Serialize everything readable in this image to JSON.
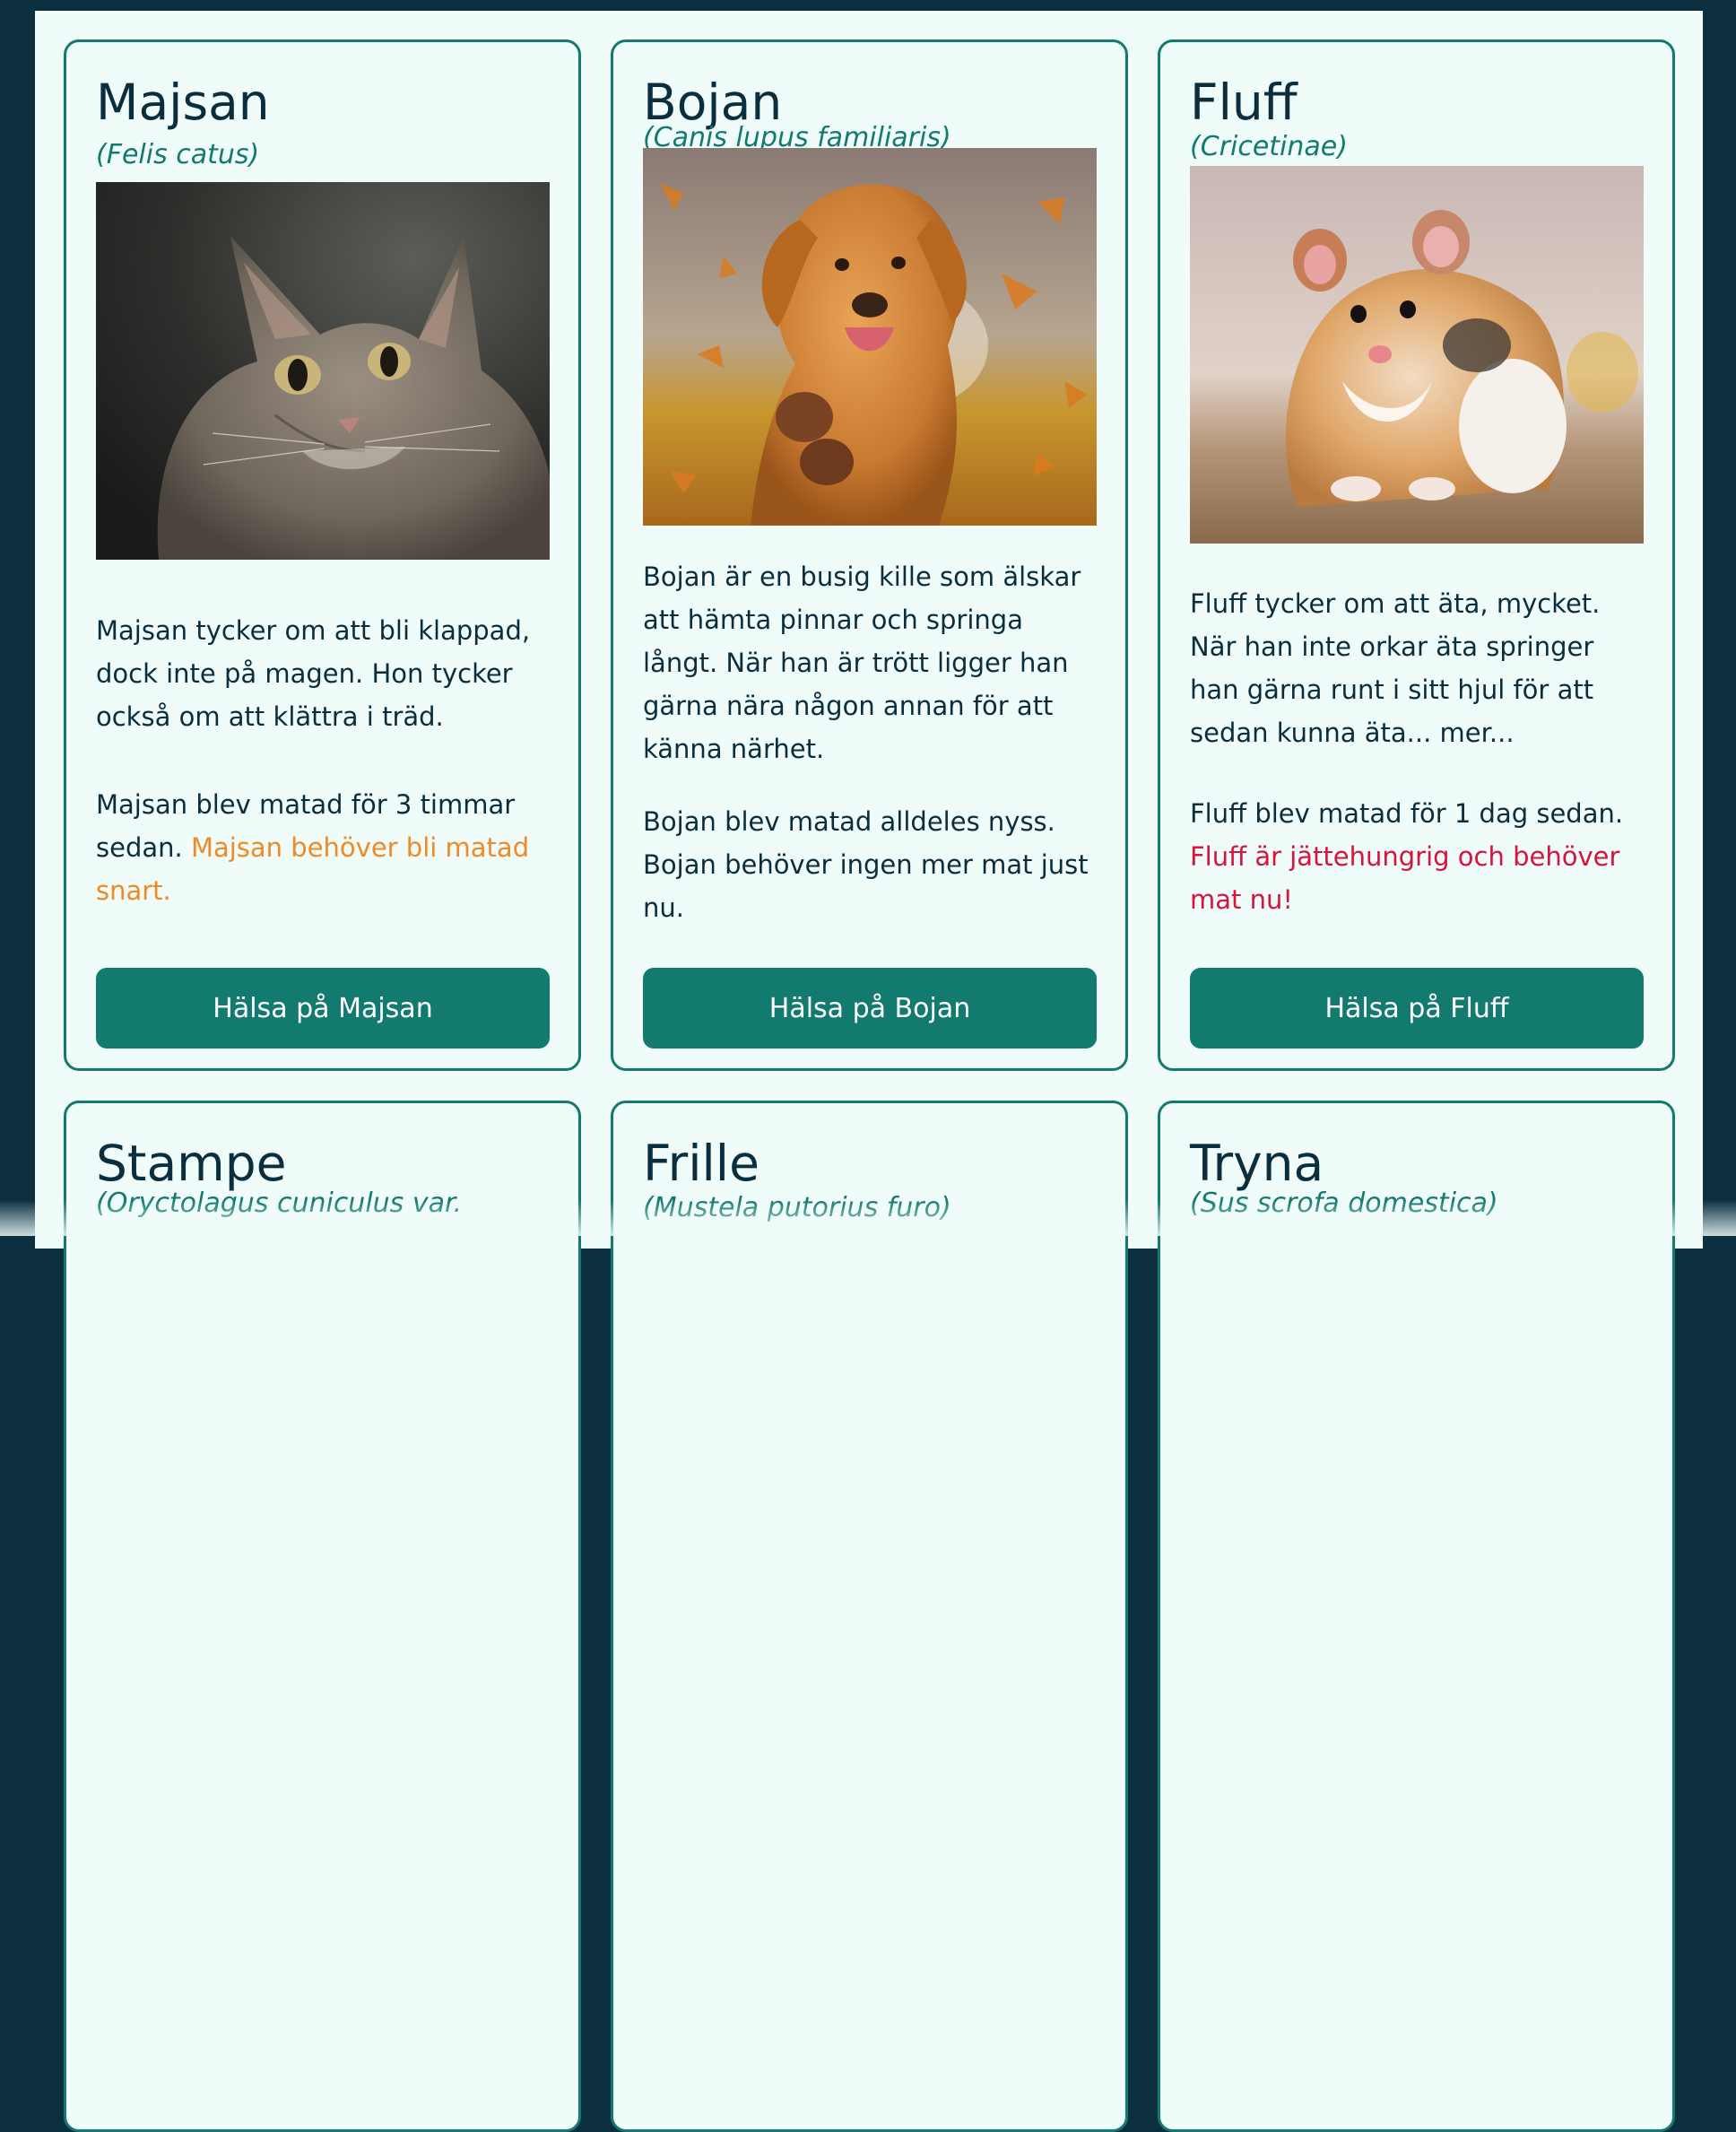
{
  "pets": [
    {
      "name": "Majsan",
      "latin": "(Felis catus)",
      "description": "Majsan tycker om att bli klappad, dock inte på magen. Hon tycker också om att klättra i träd.",
      "fed_text": "Majsan blev matad för 3 timmar sedan.",
      "status_text": "Majsan behöver bli matad snart.",
      "button_label": "Hälsa på Majsan",
      "photo_icon": "cat-photo"
    },
    {
      "name": "Bojan",
      "latin": "(Canis lupus familiaris)",
      "description": "Bojan är en busig kille som älskar att hämta pinnar och springa långt. När han är trött ligger han gärna nära någon annan för att känna närhet.",
      "fed_text": "Bojan blev matad alldeles nyss.",
      "status_text": "Bojan behöver ingen mer mat just nu.",
      "button_label": "Hälsa på Bojan",
      "photo_icon": "dog-photo"
    },
    {
      "name": "Fluff",
      "latin": "(Cricetinae)",
      "description": "Fluff tycker om att äta, mycket. När han inte orkar äta springer han gärna runt i sitt hjul för att sedan kunna äta... mer...",
      "fed_text": "Fluff blev matad för 1 dag sedan.",
      "status_text": "Fluff är jättehungrig och behöver mat nu!",
      "button_label": "Hälsa på Fluff",
      "photo_icon": "hamster-photo"
    },
    {
      "name": "Stampe",
      "latin": "(Oryctolagus cuniculus var."
    },
    {
      "name": "Frille",
      "latin": "(Mustela putorius furo)"
    },
    {
      "name": "Tryna",
      "latin": "(Sus scrofa domestica)"
    }
  ],
  "colors": {
    "background": "#0c2f40",
    "page": "#f0fcfa",
    "accent": "#137a6f",
    "text": "#0b2e3f",
    "warning": "#f08a26",
    "danger": "#d7143b"
  }
}
